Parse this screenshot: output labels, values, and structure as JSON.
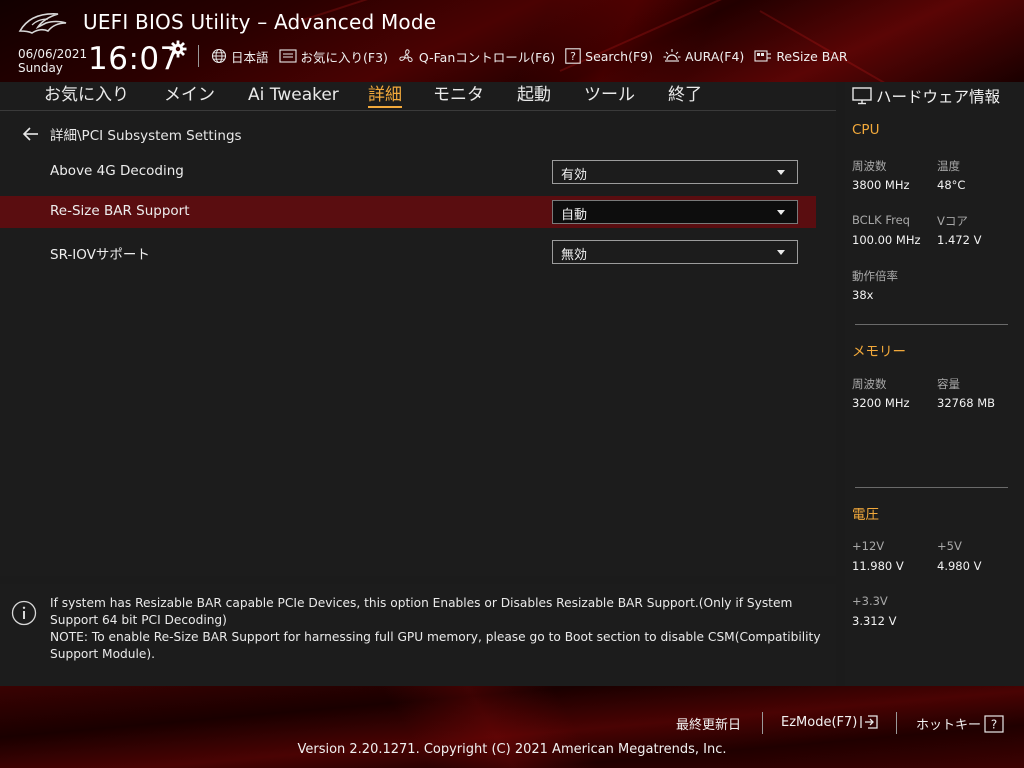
{
  "header": {
    "title": "UEFI BIOS Utility – Advanced Mode",
    "date": "06/06/2021",
    "day": "Sunday",
    "time": "16:07",
    "toolbar": [
      {
        "label": "日本語",
        "icon": "globe-icon"
      },
      {
        "label": "お気に入り(F3)",
        "icon": "favorites-icon"
      },
      {
        "label": "Q-Fanコントロール(F6)",
        "icon": "fan-icon"
      },
      {
        "label": "Search(F9)",
        "icon": "help-box-icon"
      },
      {
        "label": "AURA(F4)",
        "icon": "aura-icon"
      },
      {
        "label": "ReSize BAR",
        "icon": "resize-bar-icon"
      }
    ]
  },
  "tabs": [
    {
      "label": "お気に入り",
      "active": false
    },
    {
      "label": "メイン",
      "active": false
    },
    {
      "label": "Ai Tweaker",
      "active": false
    },
    {
      "label": "詳細",
      "active": true
    },
    {
      "label": "モニタ",
      "active": false
    },
    {
      "label": "起動",
      "active": false
    },
    {
      "label": "ツール",
      "active": false
    },
    {
      "label": "終了",
      "active": false
    }
  ],
  "breadcrumb": "詳細\\PCI Subsystem Settings",
  "settings": [
    {
      "label": "Above 4G Decoding",
      "value": "有効",
      "selected": false
    },
    {
      "label": "Re-Size BAR Support",
      "value": "自動",
      "selected": true
    },
    {
      "label": "SR-IOVサポート",
      "value": "無効",
      "selected": false
    }
  ],
  "help": {
    "text1": "If system has Resizable BAR capable PCIe Devices, this option Enables or Disables Resizable BAR Support.(Only if System Support 64 bit PCI Decoding)",
    "text2": "NOTE: To enable Re-Size BAR Support for harnessing full GPU memory, please go to Boot section to disable CSM(Compatibility Support Module)."
  },
  "hardware": {
    "title": "ハードウェア情報",
    "cpu": {
      "section": "CPU",
      "freq_label": "周波数",
      "freq": "3800 MHz",
      "temp_label": "温度",
      "temp": "48°C",
      "bclk_label": "BCLK Freq",
      "bclk": "100.00 MHz",
      "vcore_label": "Vコア",
      "vcore": "1.472 V",
      "ratio_label": "動作倍率",
      "ratio": "38x"
    },
    "memory": {
      "section": "メモリー",
      "freq_label": "周波数",
      "freq": "3200 MHz",
      "cap_label": "容量",
      "cap": "32768 MB"
    },
    "voltage": {
      "section": "電圧",
      "v12_label": "+12V",
      "v12": "11.980 V",
      "v5_label": "+5V",
      "v5": "4.980 V",
      "v33_label": "+3.3V",
      "v33": "3.312 V"
    }
  },
  "footer": {
    "last_modified": "最終更新日",
    "ezmode": "EzMode(F7)",
    "hotkeys": "ホットキー",
    "version": "Version 2.20.1271. Copyright (C) 2021 American Megatrends, Inc."
  },
  "colors": {
    "accent": "#f2a93b",
    "selected_row": "#5a0d10"
  }
}
